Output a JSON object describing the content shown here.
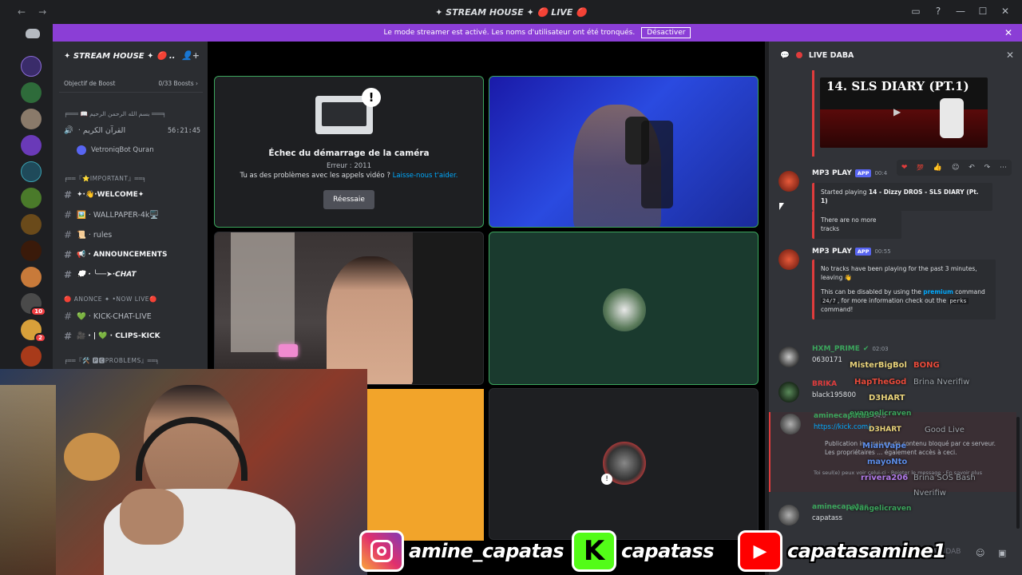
{
  "titlebar": {
    "nav_back": "←",
    "nav_forward": "→",
    "title": "✦ STREAM HOUSE ✦ 🔴 LIVE 🔴",
    "icons": [
      "inbox-icon",
      "help-icon",
      "minimize-icon",
      "maximize-icon",
      "close-icon"
    ]
  },
  "banner": {
    "text": "Le mode streamer est activé. Les noms d'utilisateur ont été tronqués.",
    "button": "Désactiver",
    "close": "✕"
  },
  "server": {
    "name": "✦ STREAM HOUSE ✦ 🔴 ..",
    "boost_label": "Objectif de Boost",
    "boost_count": "0/33 Boosts ›"
  },
  "channels": [
    {
      "type": "category",
      "label": "╒═══ 📖 بسم الله الرحمن الرحيم ═══╕"
    },
    {
      "type": "voice",
      "label": "· القرآن الكريم",
      "time": "56:21:45"
    },
    {
      "type": "member",
      "label": "VetroniqBot Quran"
    },
    {
      "type": "category",
      "label": "╒══『⭐IMPORTANT』══╕"
    },
    {
      "type": "text",
      "label": "✦·👋·WELCOME✦"
    },
    {
      "type": "text",
      "label": "🖼️ · WALLPAPER-4k🖥️"
    },
    {
      "type": "text",
      "label": "📜 · rules"
    },
    {
      "type": "text",
      "label": "📢 · ANNOUNCEMENTS"
    },
    {
      "type": "text",
      "label": "💭 · ╰──➤·CHAT"
    },
    {
      "type": "category",
      "label": "🔴 ANONCE ✦ •NOW LIVE🔴"
    },
    {
      "type": "text",
      "label": "💚 · KICK-CHAT-LIVE"
    },
    {
      "type": "text",
      "label": "🎥 · | 💚 · CLIPS-KICK"
    },
    {
      "type": "category",
      "label": "╒══『🛠️ 🅿🅲PROBLEMS』══╕"
    }
  ],
  "camera_error": {
    "title": "Échec du démarrage de la caméra",
    "code": "Erreur : 2011",
    "help_text": "Tu as des problèmes avec les appels vidéo ?",
    "help_link": "Laisse-nous t'aider.",
    "retry": "Réessaie"
  },
  "chat": {
    "header": "LIVE DABA",
    "thumb_title": "14. SLS DIARY (PT.1)",
    "messages": [
      {
        "user": "MP3 PLAY",
        "tag": "APP",
        "time": "00:4",
        "user_color": "#f2f3f5",
        "embed_prefix": "Started playing ",
        "embed_bold": "14 - Dizzy DROS - SLS DIARY (Pt. 1)"
      },
      {
        "embed": "There are no more tracks"
      },
      {
        "user": "MP3 PLAY",
        "tag": "APP",
        "time": "00:55",
        "user_color": "#f2f3f5",
        "lines": [
          "No tracks have been playing for the past 3 minutes,",
          "leaving 👋",
          "This can be disabled by using the",
          "premium",
          "command",
          "24/7",
          ", for more information check out the",
          "perks",
          "command!"
        ]
      },
      {
        "user": "HXM_PRIME",
        "time": "02:03",
        "user_color": "#3ba55c",
        "text": "0630171"
      },
      {
        "user": "BRIKA",
        "user_color": "#e03c3c",
        "text": "black195800"
      },
      {
        "user": "aminecapatas",
        "time": "04:0",
        "user_color": "#3ba55c",
        "text": "https://kick.com/...",
        "notice": "Publication in... raison de contenu bloqué par ce serveur. Les propriétaires ... également accès à ceci.",
        "notice2": "Toi seul(e) peux voir celui-ci · Rejeter le message · En savoir plus"
      },
      {
        "user": "aminecapatas",
        "user_color": "#3ba55c",
        "text": "capatass"
      }
    ],
    "hover_icons": [
      "❤",
      "💯",
      "👍",
      "⋯"
    ],
    "input_placeholder": "LIVE DAB"
  },
  "overlay_names": [
    {
      "text": "MisterBigBol",
      "color": "#e8d27a"
    },
    {
      "text": "BONG",
      "color": "#e84a3a"
    },
    {
      "text": "HapTheGod",
      "color": "#e84a3a"
    },
    {
      "text": "Brina Nverifiw",
      "color": "#9aa0a6"
    },
    {
      "text": "D3HART",
      "color": "#e8d27a"
    },
    {
      "text": "evangelicraven",
      "color": "#3ba55c"
    },
    {
      "text": "D3HART",
      "color": "#e8d27a"
    },
    {
      "text": "Good Live",
      "color": "#9aa0a6"
    },
    {
      "text": "MianVape",
      "color": "#5b8ce8"
    },
    {
      "text": "mayoNto",
      "color": "#5b8ce8"
    },
    {
      "text": "rrivera206",
      "color": "#b07ae8"
    },
    {
      "text": "Brina SOS Bash",
      "color": "#9aa0a6"
    },
    {
      "text": "Nverifiw",
      "color": "#9aa0a6"
    },
    {
      "text": "evangelicraven",
      "color": "#3ba55c"
    }
  ],
  "socials": [
    {
      "platform": "instagram",
      "handle": "amine_capatas"
    },
    {
      "platform": "kick",
      "handle": "capatass"
    },
    {
      "platform": "youtube",
      "handle": "capatasamine1"
    }
  ]
}
